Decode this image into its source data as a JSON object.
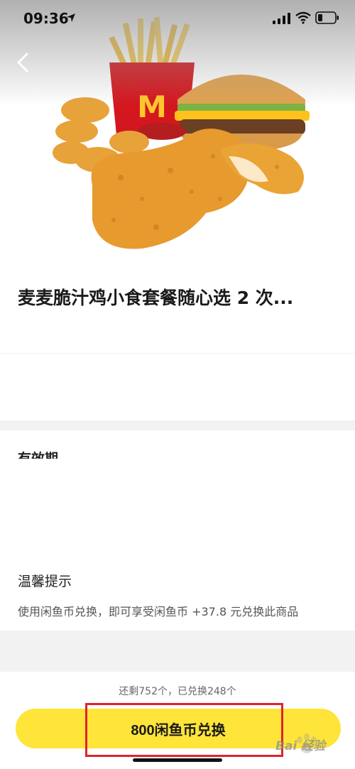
{
  "status_bar": {
    "time": "09:36"
  },
  "product": {
    "title": "麦麦脆汁鸡小食套餐随心选 2 次..."
  },
  "sections": {
    "validity_label": "有效期",
    "tips_title": "温馨提示",
    "tips_text": "使用闲鱼币兑换，即可享受闲鱼币 +37.8 元兑换此商品"
  },
  "bottom": {
    "remaining_text": "还剩752个，已兑换248个",
    "redeem_label": "800闲鱼币兑换"
  },
  "watermark": {
    "text": "Bai 经验"
  },
  "colors": {
    "accent": "#ffe43a",
    "highlight": "#e0232b",
    "section_bg": "#f2f2f2"
  }
}
